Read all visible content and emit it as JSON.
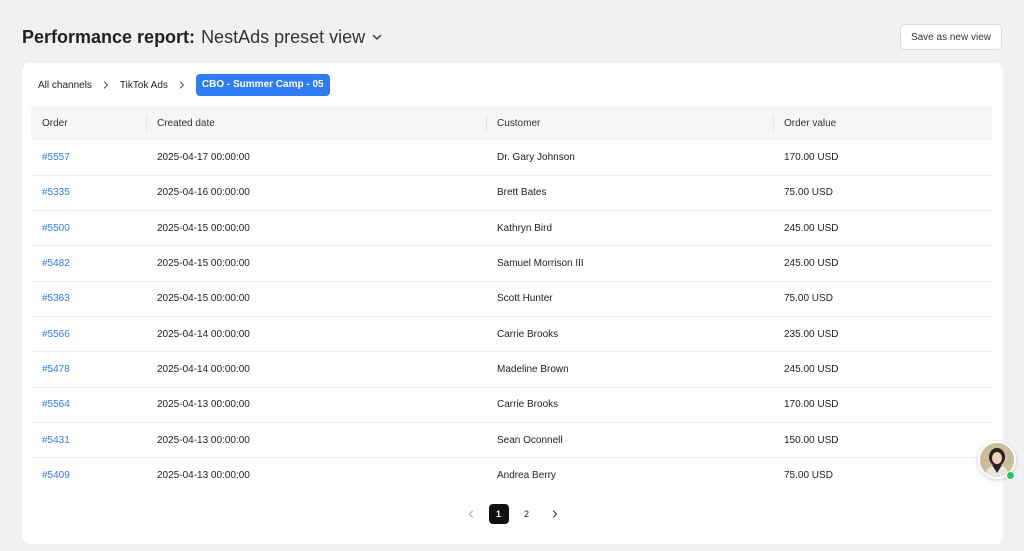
{
  "header": {
    "title": "Performance report:",
    "view_name": "NestAds preset view",
    "save_button": "Save as new view"
  },
  "breadcrumb": {
    "items": [
      "All channels",
      "TikTok Ads"
    ],
    "active": "CBO - Summer Camp - 05"
  },
  "table": {
    "columns": [
      "Order",
      "Created date",
      "Customer",
      "Order value"
    ],
    "rows": [
      {
        "order": "#5557",
        "date": "2025-04-17 00:00:00",
        "customer": "Dr. Gary Johnson",
        "value": "170.00 USD"
      },
      {
        "order": "#5335",
        "date": "2025-04-16 00:00:00",
        "customer": "Brett Bates",
        "value": "75.00 USD"
      },
      {
        "order": "#5500",
        "date": "2025-04-15 00:00:00",
        "customer": "Kathryn Bird",
        "value": "245.00 USD"
      },
      {
        "order": "#5482",
        "date": "2025-04-15 00:00:00",
        "customer": "Samuel Morrison III",
        "value": "245.00 USD"
      },
      {
        "order": "#5363",
        "date": "2025-04-15 00:00:00",
        "customer": "Scott Hunter",
        "value": "75.00 USD"
      },
      {
        "order": "#5566",
        "date": "2025-04-14 00:00:00",
        "customer": "Carrie Brooks",
        "value": "235.00 USD"
      },
      {
        "order": "#5478",
        "date": "2025-04-14 00:00:00",
        "customer": "Madeline Brown",
        "value": "245.00 USD"
      },
      {
        "order": "#5564",
        "date": "2025-04-13 00:00:00",
        "customer": "Carrie Brooks",
        "value": "170.00 USD"
      },
      {
        "order": "#5431",
        "date": "2025-04-13 00:00:00",
        "customer": "Sean Oconnell",
        "value": "150.00 USD"
      },
      {
        "order": "#5409",
        "date": "2025-04-13 00:00:00",
        "customer": "Andrea Berry",
        "value": "75.00 USD"
      }
    ]
  },
  "pagination": {
    "pages": [
      "1",
      "2"
    ],
    "current": "1"
  },
  "colors": {
    "accent": "#2f7df5",
    "background": "#f1f1f3",
    "online": "#22c55e"
  },
  "icons": {
    "view_dropdown": "chevron-down-icon",
    "breadcrumb_sep": "chevron-right-icon",
    "prev": "chevron-left-icon",
    "next": "chevron-right-icon"
  }
}
